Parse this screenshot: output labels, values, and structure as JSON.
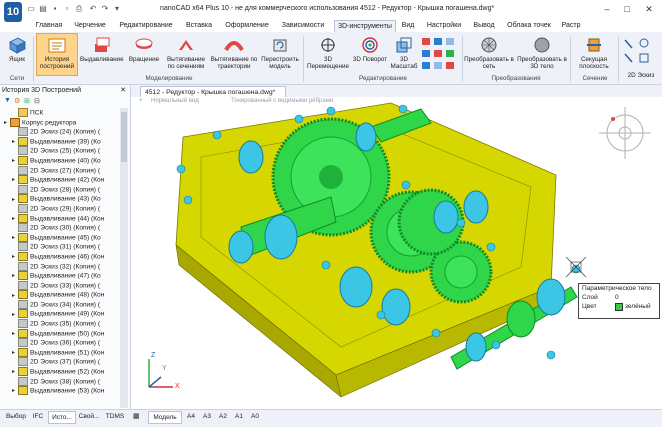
{
  "window": {
    "title": "nanoCAD x64 Plus 10 - не для коммерческого использования 4512 - Редуктор - Крышка погашена.dwg*",
    "logo": "10"
  },
  "menu_tabs": [
    "Главная",
    "Черчение",
    "Редактирование",
    "Вставка",
    "Оформление",
    "Зависимости",
    "3D-инструменты",
    "Вид",
    "Настройки",
    "Вывод",
    "Облака точек",
    "Растр"
  ],
  "ribbon": {
    "buttons": {
      "box": "Ящик",
      "history": "История построений",
      "extrude": "Выдавливание",
      "revolve": "Вращение",
      "loft": "Вытягивание по сечениям",
      "sweep": "Вытягивание по траектории",
      "rebuild": "Перестроить модель",
      "move3d": "3D Перемещение",
      "rotate3d": "3D Поворот",
      "scale3d": "3D Масштаб",
      "to_mesh": "Преобразовать в сеть",
      "to_solid": "Преобразовать в 3D тело",
      "section_plane": "Секущая плоскость",
      "sk2d": "2D Эскиз"
    },
    "groups": {
      "nets": "Сети",
      "modeling": "Моделирование",
      "editing": "Редактирование",
      "convert": "Преобразования",
      "section": "Сечение"
    }
  },
  "left_panel": {
    "title": "История 3D Построений",
    "tree": [
      {
        "label": "ПСК",
        "indent": 1,
        "kind": "folder"
      },
      {
        "label": "Корпус редуктора",
        "indent": 0,
        "kind": "root"
      },
      {
        "label": "2D Эскиз (24) (Копия) (",
        "indent": 1,
        "kind": "sketch"
      },
      {
        "label": "Выдавливание (39) (Ко",
        "indent": 1,
        "kind": "extrude"
      },
      {
        "label": "2D Эскиз (25) (Копия) (",
        "indent": 1,
        "kind": "sketch"
      },
      {
        "label": "Выдавливание (40) (Ко",
        "indent": 1,
        "kind": "extrude"
      },
      {
        "label": "2D Эскиз (27) (Копия) (",
        "indent": 1,
        "kind": "sketch"
      },
      {
        "label": "Выдавливание (42) (Кон",
        "indent": 1,
        "kind": "extrude"
      },
      {
        "label": "2D Эскиз (28) (Копия) (",
        "indent": 1,
        "kind": "sketch"
      },
      {
        "label": "Выдавливание (43) (Ко",
        "indent": 1,
        "kind": "extrude"
      },
      {
        "label": "2D Эскиз (29) (Копия) (",
        "indent": 1,
        "kind": "sketch"
      },
      {
        "label": "Выдавливание (44) (Кон",
        "indent": 1,
        "kind": "extrude"
      },
      {
        "label": "2D Эскиз (30) (Копия) (",
        "indent": 1,
        "kind": "sketch"
      },
      {
        "label": "Выдавливание (45) (Ко",
        "indent": 1,
        "kind": "extrude"
      },
      {
        "label": "2D Эскиз (31) (Копия) (",
        "indent": 1,
        "kind": "sketch"
      },
      {
        "label": "Выдавливание (46) (Кон",
        "indent": 1,
        "kind": "extrude"
      },
      {
        "label": "2D Эскиз (32) (Копия) (",
        "indent": 1,
        "kind": "sketch"
      },
      {
        "label": "Выдавливание (47) (Ко",
        "indent": 1,
        "kind": "extrude"
      },
      {
        "label": "2D Эскиз (33) (Копия) (",
        "indent": 1,
        "kind": "sketch"
      },
      {
        "label": "Выдавливание (48) (Кон",
        "indent": 1,
        "kind": "extrude"
      },
      {
        "label": "2D Эскиз (34) (Копия) (",
        "indent": 1,
        "kind": "sketch"
      },
      {
        "label": "Выдавливание (49) (Кон",
        "indent": 1,
        "kind": "extrude"
      },
      {
        "label": "2D Эскиз (35) (Копия) (",
        "indent": 1,
        "kind": "sketch"
      },
      {
        "label": "Выдавливание (50) (Кон",
        "indent": 1,
        "kind": "extrude"
      },
      {
        "label": "2D Эскиз (36) (Копия) (",
        "indent": 1,
        "kind": "sketch"
      },
      {
        "label": "Выдавливание (51) (Кон",
        "indent": 1,
        "kind": "extrude"
      },
      {
        "label": "2D Эскиз (37) (Копия) (",
        "indent": 1,
        "kind": "sketch"
      },
      {
        "label": "Выдавливание (52) (Кон",
        "indent": 1,
        "kind": "extrude"
      },
      {
        "label": "2D Эскиз (38) (Копия) (",
        "indent": 1,
        "kind": "sketch"
      },
      {
        "label": "Выдавливание (53) (Кон",
        "indent": 1,
        "kind": "extrude"
      }
    ]
  },
  "document": {
    "tab_title": "4512 - Редуктор - Крышка погашена.dwg*",
    "view_labels": [
      "Нормальный вид",
      "Тонированный с видимыми рёбрами"
    ]
  },
  "tooltip": {
    "title": "Параметрическое тело",
    "layer_label": "Слой",
    "layer_value": "0",
    "color_label": "Цвет",
    "color_value": "зелёный",
    "color_swatch": "#2ed04a"
  },
  "bottom_tabs": [
    "Выбор",
    "IFC",
    "Исто...",
    "Свой...",
    "TDMS"
  ],
  "layout_tabs": [
    "Модель",
    "A4",
    "A3",
    "A2",
    "A1",
    "A0"
  ],
  "axes": {
    "x": "X",
    "y": "Y",
    "z": "Z"
  },
  "colors": {
    "body": "#d6d600",
    "gear": "#2fd64a",
    "shaft": "#3cc6e6",
    "accent_tab": "#1f5fa8"
  }
}
